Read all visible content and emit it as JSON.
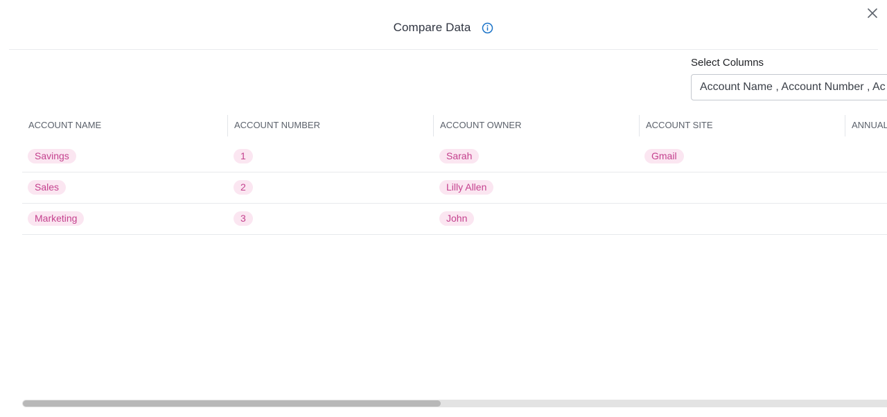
{
  "modal": {
    "title": "Compare Data"
  },
  "select_columns": {
    "label": "Select Columns",
    "value": "Account Name , Account Number , Ac"
  },
  "table": {
    "headers": [
      "ACCOUNT NAME",
      "ACCOUNT NUMBER",
      "ACCOUNT OWNER",
      "ACCOUNT SITE",
      "ANNUAL"
    ],
    "rows": [
      {
        "account_name": "Savings",
        "account_number": "1",
        "account_owner": "Sarah",
        "account_site": "Gmail"
      },
      {
        "account_name": "Sales",
        "account_number": "2",
        "account_owner": "Lilly Allen",
        "account_site": ""
      },
      {
        "account_name": "Marketing",
        "account_number": "3",
        "account_owner": "John",
        "account_site": ""
      }
    ]
  },
  "colors": {
    "tag_background": "#fbe6f1",
    "tag_text": "#c4418e",
    "info_icon": "#1a73c8",
    "title_text": "#2f3440"
  },
  "icons": {
    "info": "info-circle-icon",
    "close": "close-icon"
  }
}
